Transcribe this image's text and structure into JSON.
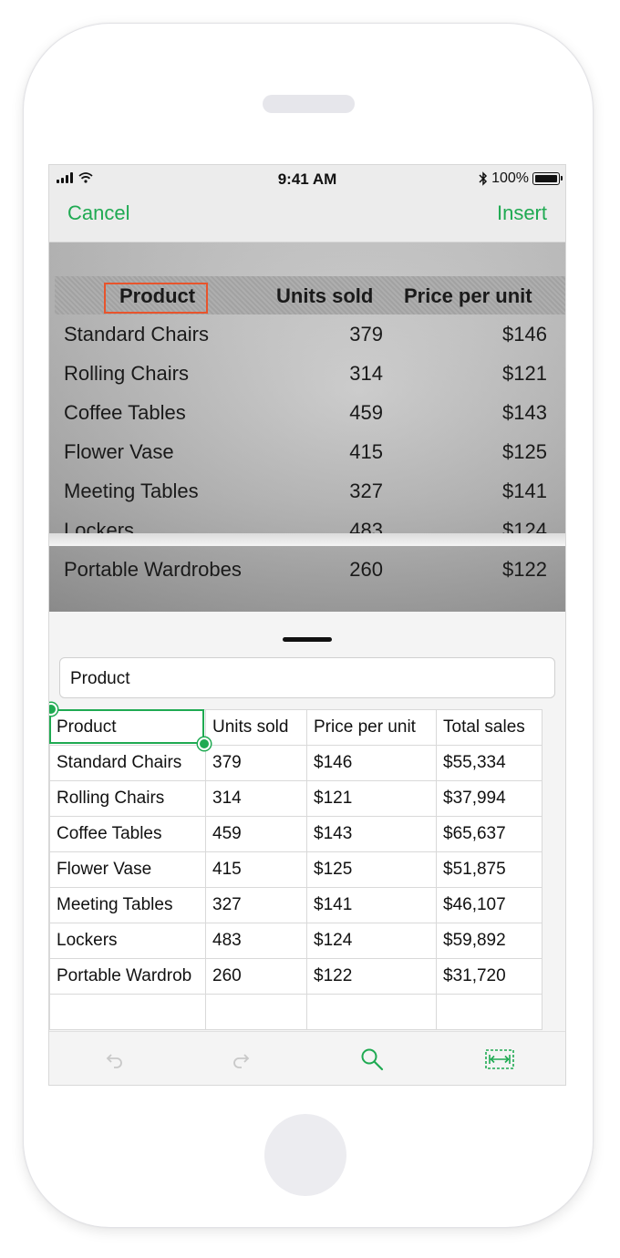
{
  "status_bar": {
    "time": "9:41 AM",
    "battery": "100%"
  },
  "nav": {
    "cancel_label": "Cancel",
    "insert_label": "Insert"
  },
  "photo": {
    "headers": [
      "Product",
      "Units sold",
      "Price per unit"
    ],
    "rows": [
      [
        "Standard Chairs",
        "379",
        "$146"
      ],
      [
        "Rolling Chairs",
        "314",
        "$121"
      ],
      [
        "Coffee Tables",
        "459",
        "$143"
      ],
      [
        "Flower Vase",
        "415",
        "$125"
      ],
      [
        "Meeting Tables",
        "327",
        "$141"
      ],
      [
        "Lockers",
        "483",
        "$124"
      ],
      [
        "Portable Wardrobes",
        "260",
        "$122"
      ]
    ]
  },
  "formula_bar": {
    "value": "Product"
  },
  "sheet": {
    "headers": [
      "Product",
      "Units sold",
      "Price per unit",
      "Total sales"
    ],
    "rows": [
      [
        "Standard Chairs",
        "379",
        "$146",
        "$55,334"
      ],
      [
        "Rolling Chairs",
        "314",
        "$121",
        "$37,994"
      ],
      [
        "Coffee Tables",
        "459",
        "$143",
        "$65,637"
      ],
      [
        "Flower Vase",
        "415",
        "$125",
        "$51,875"
      ],
      [
        "Meeting Tables",
        "327",
        "$141",
        "$46,107"
      ],
      [
        "Lockers",
        "483",
        "$124",
        "$59,892"
      ],
      [
        "Portable Wardrob",
        "260",
        "$122",
        "$31,720"
      ]
    ]
  },
  "toolbar": {
    "icons": [
      "undo-icon",
      "redo-icon",
      "search-icon",
      "fit-width-icon"
    ]
  },
  "colors": {
    "accent": "#1faa52",
    "selection": "#e8542c",
    "disabled": "#c8c8c8"
  }
}
